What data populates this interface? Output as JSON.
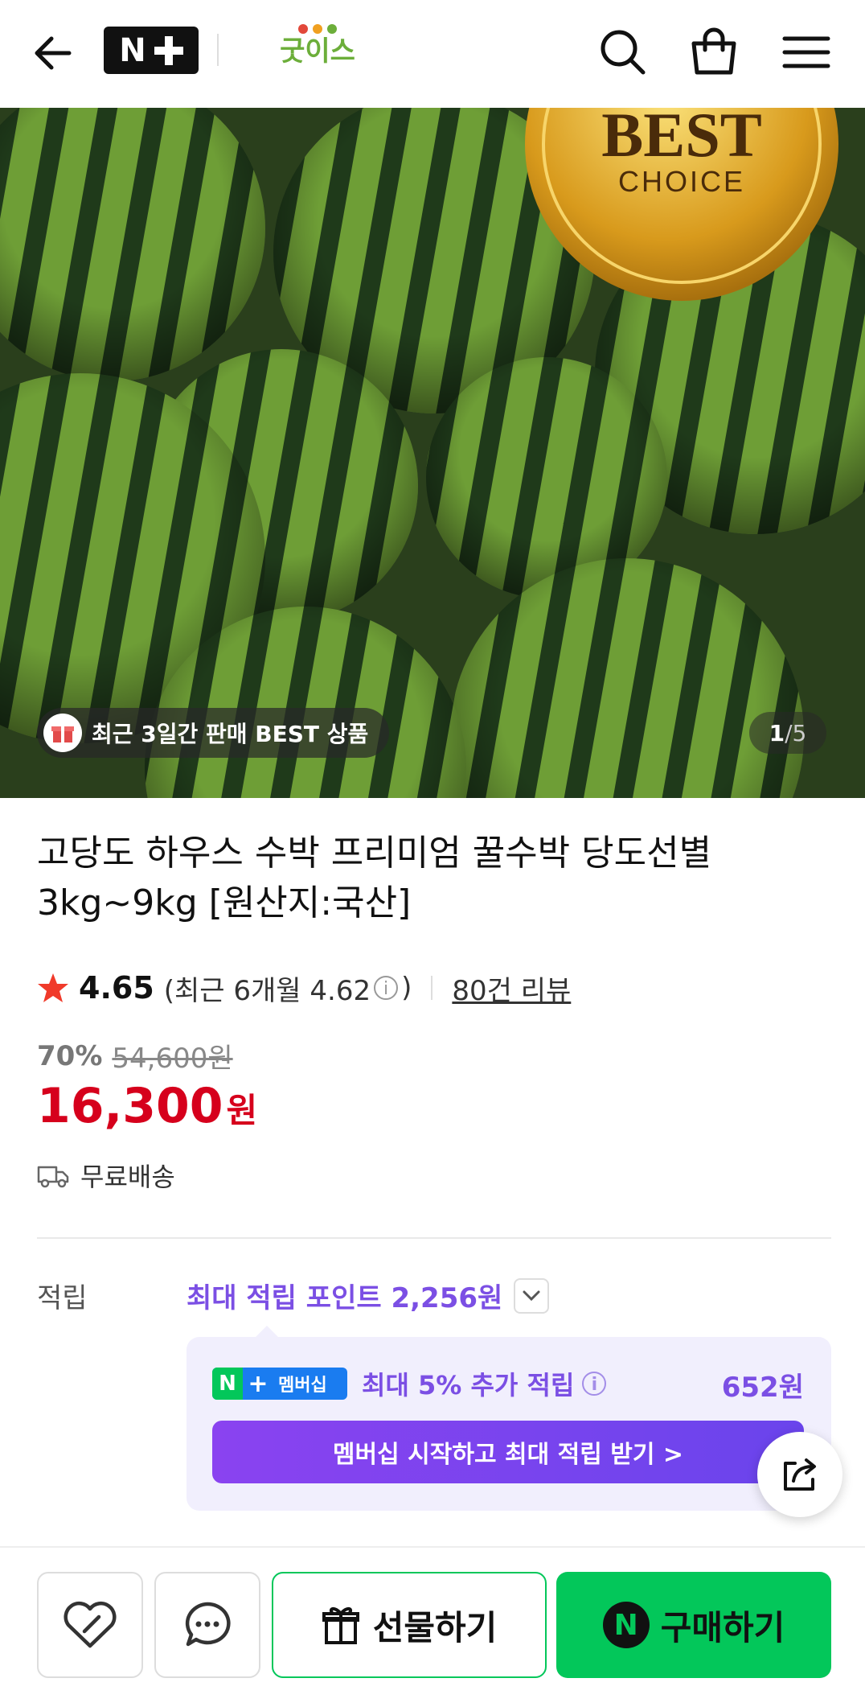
{
  "header": {
    "brand_badge": "N+",
    "store_name": "굿이스",
    "icons": [
      "back-arrow-icon",
      "search-icon",
      "shopping-bag-icon",
      "hamburger-menu-icon"
    ]
  },
  "hero": {
    "badge_text": "최근 3일간 판매 BEST 상품",
    "seal_line1": "BEST",
    "seal_line2": "CHOICE",
    "counter_current": "1",
    "counter_sep": "/",
    "counter_total": "5"
  },
  "product": {
    "title": "고당도 하우스 수박 프리미엄 꿀수박 당도선별 3kg~9kg [원산지:국산]",
    "rating": "4.65",
    "recent_rating_prefix": "(최근 6개월 4.62",
    "recent_rating_suffix": ")",
    "review_link": "80건 리뷰",
    "discount_rate": "70%",
    "original_price": "54,600원",
    "price": "16,300",
    "price_unit": "원",
    "shipping": "무료배송"
  },
  "points": {
    "label": "적립",
    "max_points": "최대 적립 포인트 2,256원",
    "membership_badge_n": "N",
    "membership_badge_plus": "+",
    "membership_badge_text": "멤버십",
    "promo_text": "최대 5% 추가 적립",
    "promo_amount": "652원",
    "cta": "멤버십 시작하고 최대 적립 받기 >"
  },
  "bottom_bar": {
    "gift_label": "선물하기",
    "buy_badge": "N",
    "buy_label": "구매하기"
  },
  "colors": {
    "price_red": "#d6001c",
    "naver_green": "#03c75a",
    "membership_purple": "#7b4fe4",
    "promo_bg": "#f1effd"
  }
}
